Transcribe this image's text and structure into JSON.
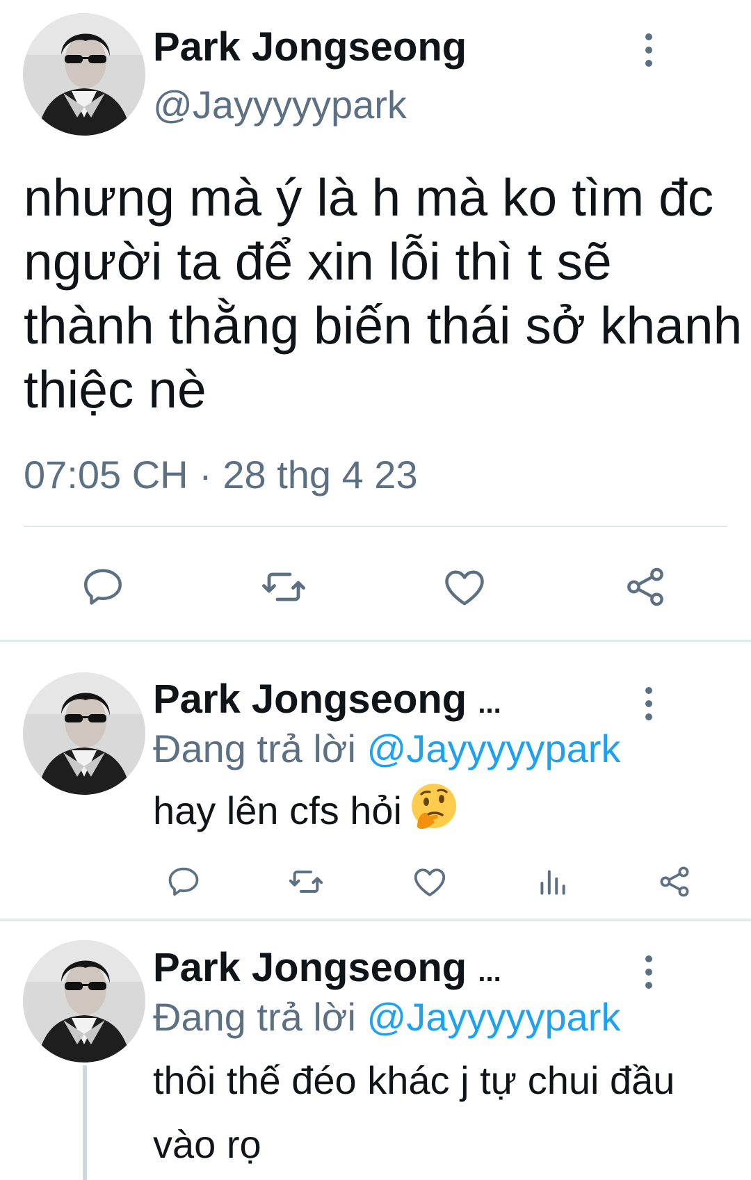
{
  "main_tweet": {
    "author_name": "Park Jongseong",
    "author_handle": "@Jayyyyypark",
    "text": "nhưng mà ý là h mà ko tìm đc người ta để xin lỗi thì t sẽ thành thằng biến thái sở khanh thiệc nè",
    "timestamp": "07:05 CH · 28 thg 4 23",
    "actions": [
      "reply-icon",
      "retweet-icon",
      "like-icon",
      "share-icon"
    ]
  },
  "replies": [
    {
      "author_name": "Park Jongseong",
      "name_truncation": "...",
      "replying_prefix": "Đang trả lời",
      "replying_to": "@Jayyyyypark",
      "text": "hay lên cfs hỏi",
      "emoji": "thinking-face",
      "actions": [
        "reply-icon",
        "retweet-icon",
        "like-icon",
        "analytics-icon",
        "share-icon"
      ]
    },
    {
      "author_name": "Park Jongseong",
      "name_truncation": "...",
      "replying_prefix": "Đang trả lời",
      "replying_to": "@Jayyyyypark",
      "text": "thôi thế đéo khác j tự chui đầu vào rọ"
    }
  ],
  "colors": {
    "text": "#0f1419",
    "secondary": "#5b7083",
    "mention": "#1da1f2",
    "divider": "#e1e8ed"
  }
}
